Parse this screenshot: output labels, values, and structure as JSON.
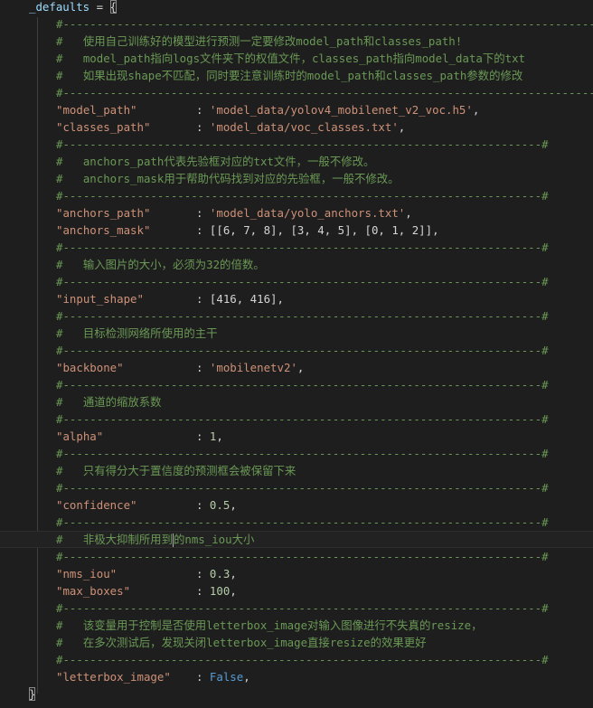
{
  "code": {
    "var_name": "_defaults",
    "assign": " = ",
    "open_brace": "{",
    "close_brace": "}",
    "dash_long": "#----------------------------------------------------------------------------------#",
    "dash_short": "#-----------------------------------------------------------------------#",
    "comment_1a": "#   使用自己训练好的模型进行预测一定要修改model_path和classes_path!",
    "comment_1b": "#   model_path指向logs文件夹下的权值文件，classes_path指向model_data下的txt",
    "comment_1c": "#   如果出现shape不匹配，同时要注意训练时的model_path和classes_path参数的修改",
    "model_path_key": "\"model_path\"",
    "model_path_val": "'model_data/yolov4_mobilenet_v2_voc.h5'",
    "classes_path_key": "\"classes_path\"",
    "classes_path_val": "'model_data/voc_classes.txt'",
    "comment_2a": "#   anchors_path代表先验框对应的txt文件，一般不修改。",
    "comment_2b": "#   anchors_mask用于帮助代码找到对应的先验框，一般不修改。",
    "anchors_path_key": "\"anchors_path\"",
    "anchors_path_val": "'model_data/yolo_anchors.txt'",
    "anchors_mask_key": "\"anchors_mask\"",
    "anchors_mask_val": "[[6, 7, 8], [3, 4, 5], [0, 1, 2]]",
    "comment_3": "#   输入图片的大小，必须为32的倍数。",
    "input_shape_key": "\"input_shape\"",
    "input_shape_val": "[416, 416]",
    "comment_4": "#   目标检测网络所使用的主干",
    "backbone_key": "\"backbone\"",
    "backbone_val": "'mobilenetv2'",
    "comment_5": "#   通道的缩放系数",
    "alpha_key": "\"alpha\"",
    "alpha_val": "1",
    "comment_6": "#   只有得分大于置信度的预测框会被保留下来",
    "confidence_key": "\"confidence\"",
    "confidence_val": "0.5",
    "comment_7a": "#   非极大抑制所用到",
    "comment_7b": "的nms_iou大小",
    "nms_iou_key": "\"nms_iou\"",
    "nms_iou_val": "0.3",
    "max_boxes_key": "\"max_boxes\"",
    "max_boxes_val": "100",
    "comment_8a": "#   该变量用于控制是否使用letterbox_image对输入图像进行不失真的resize，",
    "comment_8b": "#   在多次测试后，发现关闭letterbox_image直接resize的效果更好",
    "letterbox_key": "\"letterbox_image\"",
    "letterbox_val": "False",
    "colon": ": ",
    "comma": ","
  }
}
